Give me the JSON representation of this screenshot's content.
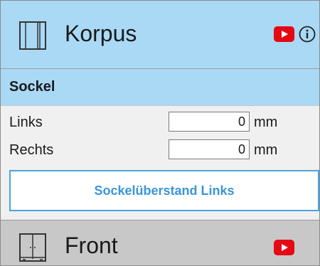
{
  "korpus": {
    "title": "Korpus",
    "icons": [
      "wardrobe-icon",
      "youtube-icon",
      "info-icon"
    ]
  },
  "sockel": {
    "title": "Sockel",
    "rows": [
      {
        "label": "Links",
        "value": "0",
        "unit": "mm"
      },
      {
        "label": "Rechts",
        "value": "0",
        "unit": "mm"
      }
    ],
    "button_label": "Sockelüberstand Links"
  },
  "front": {
    "title": "Front",
    "icons": [
      "double-door-icon",
      "youtube-icon"
    ]
  },
  "colors": {
    "header_blue": "#aad9f5",
    "button_blue": "#3a95d8",
    "youtube_red": "#e50914",
    "front_gray": "#c8c8c8"
  }
}
